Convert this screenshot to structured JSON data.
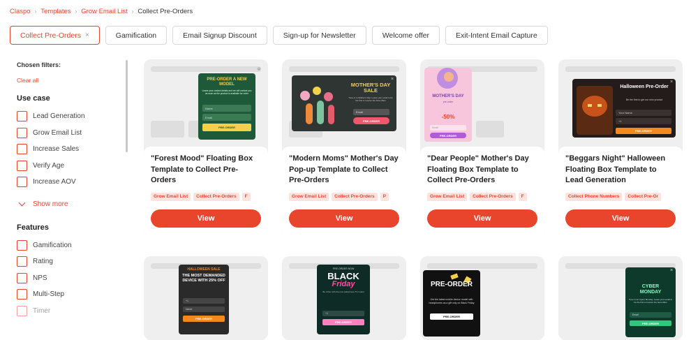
{
  "breadcrumb": [
    "Claspo",
    "Templates",
    "Grow Email List",
    "Collect Pre-Orders"
  ],
  "tags": [
    {
      "label": "Collect Pre-Orders",
      "active": true
    },
    {
      "label": "Gamification"
    },
    {
      "label": "Email Signup Discount"
    },
    {
      "label": "Sign-up for Newsletter"
    },
    {
      "label": "Welcome offer"
    },
    {
      "label": "Exit-Intent Email Capture"
    }
  ],
  "sidebar": {
    "chosen_filters": "Chosen filters:",
    "clear_all": "Clear all",
    "use_case_title": "Use case",
    "use_case": [
      "Lead Generation",
      "Grow Email List",
      "Increase Sales",
      "Verify Age",
      "Increase AOV"
    ],
    "show_more": "Show more",
    "features_title": "Features",
    "features": [
      "Gamification",
      "Rating",
      "NPS",
      "Multi-Step",
      "Timer"
    ]
  },
  "cards": [
    {
      "title": "\"Forest Mood\" Floating Box Template to Collect Pre-Orders",
      "chips": [
        "Grow Email List",
        "Collect Pre-Orders",
        "F"
      ],
      "button": "View",
      "preview": {
        "heading": "PRE-ORDER A NEW MODEL",
        "text": "Leave your contact details and we will contact you as soon as the product is available for order",
        "field1": "Name",
        "field2": "Email",
        "cta": "PRE-ORDER"
      }
    },
    {
      "title": "\"Modern Moms\" Mother's Day Pop-up Template to Collect Pre-Orders",
      "chips": [
        "Grow Email List",
        "Collect Pre-Orders",
        "P"
      ],
      "button": "View",
      "preview": {
        "heading": "MOTHER'S DAY SALE",
        "text": "Tune in to Mother's Day. Leave your email to be the first to receive the best offers",
        "field1": "Email",
        "cta": "PRE-ORDER"
      }
    },
    {
      "title": "\"Dear People\" Mother's Day Floating Box Template to Collect Pre-Orders",
      "chips": [
        "Grow Email List",
        "Collect Pre-Orders",
        "F"
      ],
      "button": "View",
      "preview": {
        "heading": "MOTHER'S DAY",
        "sub": "pre-order",
        "discount": "-50%",
        "field1": "Email",
        "cta": "PRE-ORDER"
      }
    },
    {
      "title": "\"Beggars Night\" Halloween Floating Box Template to Lead Generation",
      "chips": [
        "Collect Phone Numbers",
        "Collect Pre-Or"
      ],
      "button": "View",
      "preview": {
        "heading": "Halloween Pre-Order",
        "text": "Be the first to get our new product",
        "field1": "Your Name",
        "field2": "+1",
        "cta": "PRE-ORDER"
      }
    }
  ],
  "previews_row2": [
    {
      "heading1": "HALLOWEEN SALE",
      "heading2": "THE MOST DEMANDED DEVICE WITH 25% OFF",
      "field1": "+1",
      "field2": "Name",
      "cta": "PRE-ORDER"
    },
    {
      "top": "PRE-ORDER NOW",
      "heading1": "BLACK",
      "heading2": "Friday",
      "text": "Be richer with the new widescreen TV model",
      "field1": "+1",
      "cta": "PRE-ORDER"
    },
    {
      "heading": "PRE-ORDER",
      "text": "Get the latest mobile device model with headphones as a gift only on Black Friday",
      "cta": "PRE-ORDER"
    },
    {
      "heading1": "CYBER",
      "heading2": "MONDAY",
      "text": "Tune in for Cyber Monday. Leave your email to be the first to receive the best offers",
      "field1": "Email",
      "cta": "PRE-ORDER"
    }
  ],
  "colors": {
    "accent": "#e8452c",
    "chip_bg": "#fde3dd",
    "card_bg": "#efefef"
  }
}
